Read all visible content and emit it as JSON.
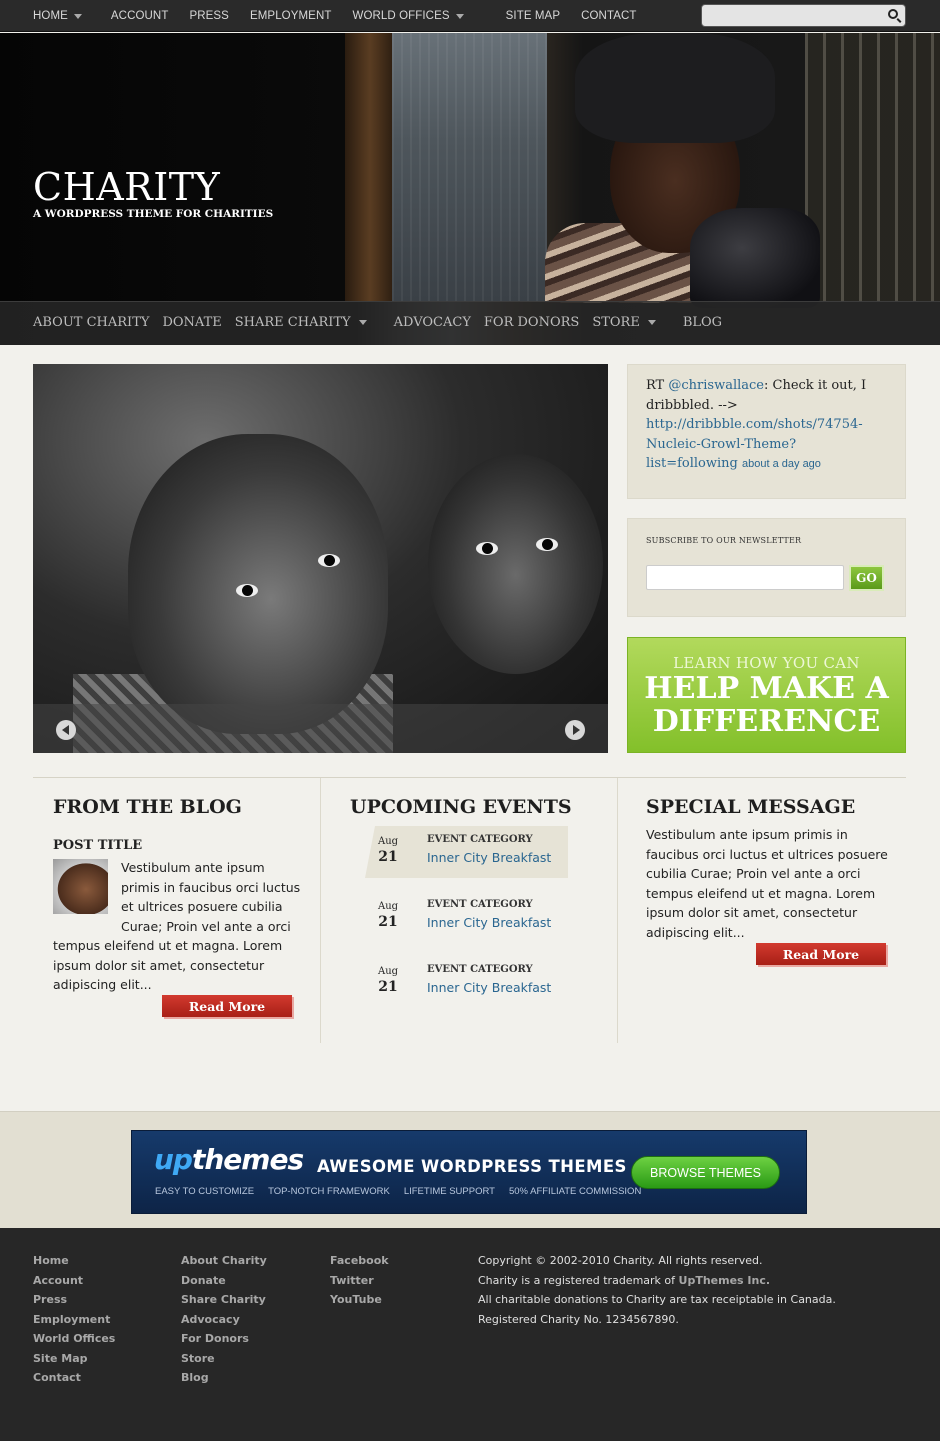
{
  "topnav": {
    "items": [
      {
        "label": "HOME",
        "dropdown": true
      },
      {
        "label": "ACCOUNT",
        "dropdown": false
      },
      {
        "label": "PRESS",
        "dropdown": false
      },
      {
        "label": "EMPLOYMENT",
        "dropdown": false
      },
      {
        "label": "WORLD OFFICES",
        "dropdown": true
      },
      {
        "label": "SITE MAP",
        "dropdown": false
      },
      {
        "label": "CONTACT",
        "dropdown": false
      }
    ],
    "search_value": "",
    "search_icon": "search-icon"
  },
  "header": {
    "logo": "CHARITY",
    "tagline": "A WORDPRESS THEME FOR CHARITIES"
  },
  "mainnav": {
    "items": [
      {
        "label": "ABOUT CHARITY",
        "dropdown": false
      },
      {
        "label": "DONATE",
        "dropdown": false
      },
      {
        "label": "SHARE CHARITY",
        "dropdown": true
      },
      {
        "label": "ADVOCACY",
        "dropdown": false
      },
      {
        "label": "FOR DONORS",
        "dropdown": false
      },
      {
        "label": "STORE",
        "dropdown": true
      },
      {
        "label": "BLOG",
        "dropdown": false
      }
    ]
  },
  "slider": {
    "prev_icon": "arrow-left-icon",
    "next_icon": "arrow-right-icon"
  },
  "tweet": {
    "prefix": "RT ",
    "handle": "@chriswallace",
    "text": ": Check it out, I dribbbled. -->",
    "link": "http://dribbble.com/shots/74754-Nucleic-Growl-Theme?list=following",
    "link_line1": "http://dribbble.com/shots/74754-",
    "link_line2": "Nucleic-Growl-Theme?",
    "link_line3": "list=following",
    "time": "about a day ago"
  },
  "newsletter": {
    "label": "SUBSCRIBE TO OUR NEWSLETTER",
    "email_value": "",
    "button": "GO"
  },
  "cta": {
    "small": "LEARN HOW YOU CAN",
    "big_line1": "HELP MAKE A",
    "big_line2": "DIFFERENCE"
  },
  "blog": {
    "title": "FROM THE BLOG",
    "post_title": "POST TITLE",
    "text_line1": "Vestibulum ante ipsum",
    "text_line2": "primis in faucibus orci luctus",
    "text_line3": "et ultrices posuere cubilia",
    "text_line4": "Curae; Proin vel ante a orci",
    "text_line5": "tempus eleifend ut et magna. Lorem",
    "text_line6": "ipsum dolor sit amet, consectetur",
    "text_line7": "adipiscing elit...",
    "read_more": "Read More"
  },
  "events": {
    "title": "UPCOMING EVENTS",
    "items": [
      {
        "month": "Aug",
        "day": "21",
        "category": "EVENT CATEGORY",
        "name": "Inner City Breakfast"
      },
      {
        "month": "Aug",
        "day": "21",
        "category": "EVENT CATEGORY",
        "name": "Inner City Breakfast"
      },
      {
        "month": "Aug",
        "day": "21",
        "category": "EVENT CATEGORY",
        "name": "Inner City Breakfast"
      }
    ]
  },
  "special": {
    "title": "SPECIAL MESSAGE",
    "text_line1": "Vestibulum ante ipsum primis in",
    "text_line2": "faucibus orci luctus et ultrices posuere",
    "text_line3": "cubilia Curae; Proin vel ante a orci",
    "text_line4": "tempus eleifend ut et magna. Lorem",
    "text_line5": "ipsum dolor sit amet, consectetur",
    "text_line6": "adipiscing elit...",
    "read_more": "Read More"
  },
  "banner": {
    "logo_up": "up",
    "logo_themes": "themes",
    "headline": "AWESOME WORDPRESS THEMES",
    "features": [
      "EASY TO CUSTOMIZE",
      "TOP-NOTCH FRAMEWORK",
      "LIFETIME SUPPORT",
      "50% AFFILIATE COMMISSION"
    ],
    "button": "BROWSE THEMES"
  },
  "footer": {
    "col1": [
      "Home",
      "Account",
      "Press",
      "Employment",
      "World Offices",
      "Site Map",
      "Contact"
    ],
    "col2": [
      "About Charity",
      "Donate",
      "Share Charity",
      "Advocacy",
      "For Donors",
      "Store",
      "Blog"
    ],
    "col3": [
      "Facebook",
      "Twitter",
      "YouTube"
    ],
    "copyright": "Copyright © 2002-2010 Charity. All rights reserved.",
    "trademark_prefix": "Charity is a registered trademark of ",
    "trademark_company": "UpThemes Inc.",
    "tax_note": "All charitable donations to Charity are tax receiptable in Canada.",
    "registration": "Registered Charity No. 1234567890."
  },
  "colors": {
    "accent_green": "#8dc63f",
    "read_more_red": "#c0281f",
    "link_blue": "#2a6690",
    "footer_bg": "#272727"
  }
}
